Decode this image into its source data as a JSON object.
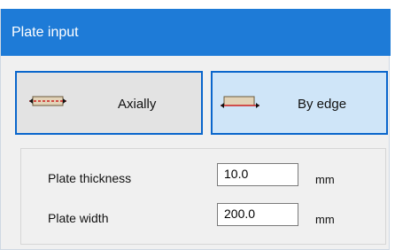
{
  "window": {
    "title": "Plate input"
  },
  "mode_buttons": [
    {
      "label": "Axially",
      "icon": "plate-axial-icon",
      "selected": false
    },
    {
      "label": "By edge",
      "icon": "plate-edge-icon",
      "selected": true
    }
  ],
  "fields": {
    "thickness": {
      "label": "Plate thickness",
      "value": "10.0",
      "unit": "mm"
    },
    "width": {
      "label": "Plate width",
      "value": "200.0",
      "unit": "mm"
    }
  },
  "colors": {
    "titlebar": "#1e7bd7",
    "selected_border": "#0a66cc",
    "plate_fill": "#e2d3b8",
    "plate_line": "#cc1f1f"
  }
}
